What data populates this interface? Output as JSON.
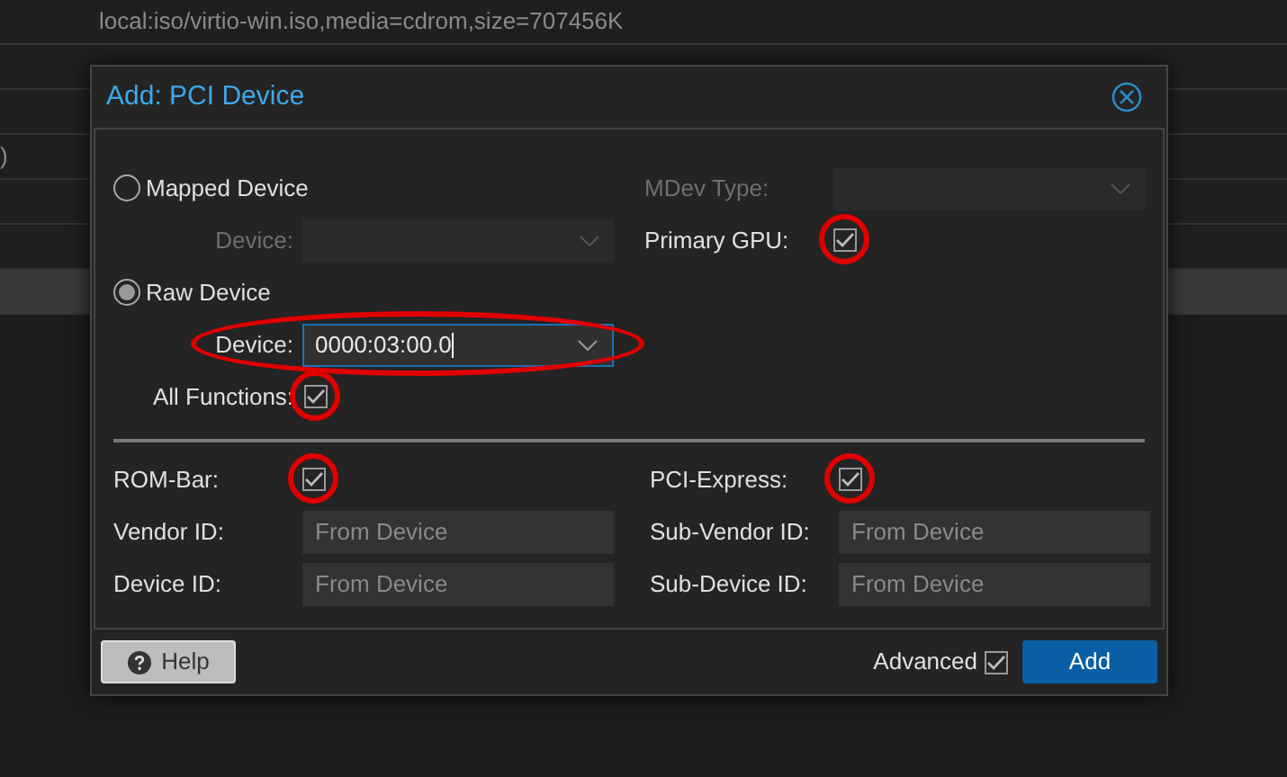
{
  "background_table": {
    "rows": [
      {
        "selected": false,
        "column_2": "local:iso/virtio-win.iso,media=cdrom,size=707456K"
      },
      {
        "selected": false
      },
      {
        "selected": false
      },
      {
        "selected": false,
        "column_1": ")"
      },
      {
        "selected": false
      },
      {
        "selected": false
      },
      {
        "selected": true
      }
    ]
  },
  "dialog": {
    "title": "Add: PCI Device",
    "device_modes": [
      {
        "label": "Mapped Device",
        "selected": false,
        "device": {
          "label": "Device:",
          "disabled": true
        }
      },
      {
        "label": "Raw Device",
        "selected": true,
        "device": {
          "label": "Device:",
          "disabled": false,
          "value": "0000:03:00.0"
        }
      }
    ],
    "all_functions": {
      "label": "All Functions:",
      "checked": true
    },
    "mdev_type": {
      "label": "MDev Type:",
      "disabled": true
    },
    "primary_gpu": {
      "label": "Primary GPU:",
      "checked": true
    },
    "rom_bar": {
      "label": "ROM-Bar:",
      "checked": true
    },
    "pci_express": {
      "label": "PCI-Express:",
      "checked": true
    },
    "id_fields": [
      {
        "label": "Vendor ID:",
        "placeholder": "From Device"
      },
      {
        "label": "Sub-Vendor ID:",
        "placeholder": "From Device"
      },
      {
        "label": "Device ID:",
        "placeholder": "From Device"
      },
      {
        "label": "Sub-Device ID:",
        "placeholder": "From Device"
      }
    ],
    "footer": {
      "help_button": "Help",
      "advanced": {
        "label": "Advanced",
        "checked": true
      },
      "add_button": "Add"
    }
  }
}
